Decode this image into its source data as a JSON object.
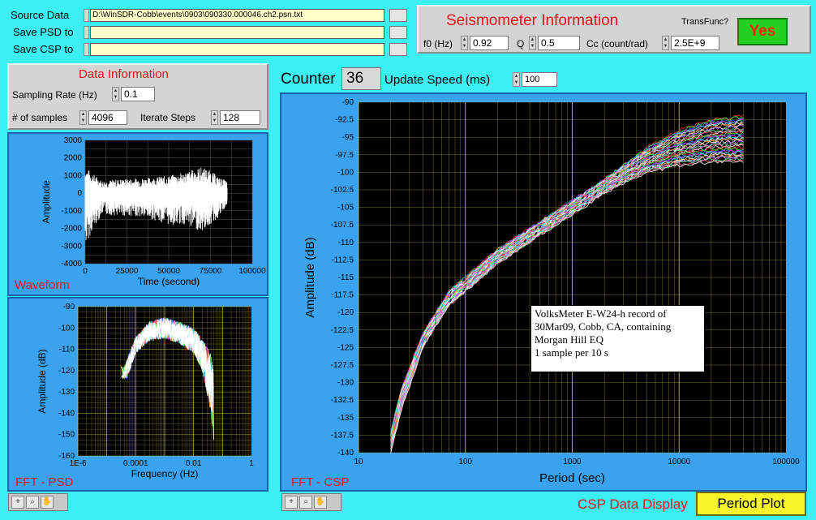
{
  "files": {
    "source_label": "Source Data",
    "source_path": "D:\\WinSDR-Cobb\\events\\0903\\090330.000046.ch2.psn.txt",
    "save_psd_label": "Save PSD to",
    "save_psd_path": "",
    "save_csp_label": "Save CSP to",
    "save_csp_path": ""
  },
  "seismometer": {
    "title": "Seismometer Information",
    "transfunc_label": "TransFunc?",
    "transfunc_button": "Yes",
    "f0_label": "f0 (Hz)",
    "f0_value": "0.92",
    "q_label": "Q",
    "q_value": "0.5",
    "cc_label": "Cc (count/rad)",
    "cc_value": "2.5E+9"
  },
  "data_info": {
    "title": "Data Information",
    "sampling_label": "Sampling Rate (Hz)",
    "sampling_value": "0.1",
    "samples_label": "# of samples",
    "samples_value": "4096",
    "iterate_label": "Iterate Steps",
    "iterate_value": "128"
  },
  "counter": {
    "label": "Counter",
    "value": "36",
    "speed_label": "Update Speed (ms)",
    "speed_value": "100"
  },
  "waveform": {
    "caption": "Waveform",
    "xlabel": "Time (second)",
    "ylabel": "Amplitude",
    "xticks": [
      "0",
      "25000",
      "50000",
      "75000",
      "100000"
    ],
    "yticks": [
      "3000",
      "2000",
      "1000",
      "0",
      "-1000",
      "-2000",
      "-3000",
      "-4000"
    ]
  },
  "psd": {
    "caption": "FFT - PSD",
    "xlabel": "Frequency (Hz)",
    "ylabel": "Amplitude (dB)",
    "xticks": [
      "1E-6",
      "0.0001",
      "0.01",
      "1"
    ],
    "yticks": [
      "-90",
      "-100",
      "-110",
      "-120",
      "-130",
      "-140",
      "-150",
      "-160"
    ]
  },
  "csp": {
    "caption": "FFT - CSP",
    "xlabel": "Period (sec)",
    "ylabel": "Amplitude (dB)",
    "xticks": [
      "10",
      "100",
      "1000",
      "10000",
      "100000"
    ],
    "yticks": [
      "-90",
      "-92.5",
      "-95",
      "-97.5",
      "-100",
      "-102.5",
      "-105",
      "-107.5",
      "-110",
      "-112.5",
      "-115",
      "-117.5",
      "-120",
      "-122.5",
      "-125",
      "-127.5",
      "-130",
      "-132.5",
      "-135",
      "-137.5",
      "-140"
    ],
    "annotation": [
      "VolksMeter E-W24-h record of",
      "30Mar09, Cobb, CA, containing",
      "Morgan Hill EQ",
      "1 sample per 10 s"
    ]
  },
  "display": {
    "label": "CSP Data Display",
    "value": "Period Plot"
  },
  "colors": {
    "title_red": "#e8101a",
    "yes_green": "#22d020",
    "display_yellow": "#f6f62a",
    "grid_yellow": "#c8c84a",
    "plot_bg": "#000000"
  },
  "chart_data": [
    {
      "type": "line",
      "title": "",
      "xlabel": "Time (second)",
      "ylabel": "Amplitude",
      "xlim": [
        0,
        100000
      ],
      "ylim": [
        -4000,
        3000
      ],
      "grid": true,
      "series": [
        {
          "x": [
            0,
            5000,
            10000,
            20000,
            30000,
            40000,
            50000,
            60000,
            70000,
            75000,
            80000,
            85000
          ],
          "y": [
            1500,
            1100,
            700,
            800,
            850,
            900,
            1000,
            1200,
            1500,
            1300,
            900,
            700
          ]
        },
        {
          "x": [
            0,
            5000,
            10000,
            20000,
            30000,
            40000,
            50000,
            60000,
            70000,
            75000,
            80000,
            85000
          ],
          "y": [
            -3000,
            -2000,
            -1200,
            -1300,
            -1300,
            -1500,
            -1800,
            -1800,
            -2200,
            -1800,
            -1400,
            -700
          ]
        }
      ]
    },
    {
      "type": "line",
      "title": "",
      "xlabel": "Frequency (Hz)",
      "ylabel": "Amplitude (dB)",
      "xscale": "log",
      "xlim": [
        1e-06,
        1
      ],
      "ylim": [
        -160,
        -90
      ],
      "grid": true,
      "series": [
        {
          "x": [
            4e-05,
            0.0001,
            0.0003,
            0.001,
            0.003,
            0.01,
            0.02,
            0.04,
            0.05
          ],
          "y": [
            -118,
            -104,
            -97,
            -95,
            -97,
            -100,
            -105,
            -112,
            -120
          ]
        },
        {
          "x": [
            5e-05,
            0.0001,
            0.0003,
            0.001,
            0.003,
            0.01,
            0.02,
            0.04,
            0.05
          ],
          "y": [
            -124,
            -112,
            -106,
            -105,
            -107,
            -112,
            -120,
            -140,
            -155
          ]
        }
      ]
    },
    {
      "type": "line",
      "title": "",
      "xlabel": "Period (sec)",
      "ylabel": "Amplitude (dB)",
      "xscale": "log",
      "xlim": [
        10,
        100000
      ],
      "ylim": [
        -140,
        -90
      ],
      "grid": true,
      "series": [
        {
          "x": [
            20,
            25,
            40,
            70,
            100,
            200,
            500,
            1000,
            2000,
            3000,
            5000,
            10000,
            20000,
            40000
          ],
          "y": [
            -137,
            -131,
            -123,
            -117,
            -115,
            -111,
            -107,
            -104,
            -101,
            -99,
            -96.5,
            -94,
            -92.5,
            -92
          ]
        },
        {
          "x": [
            20,
            25,
            40,
            70,
            100,
            200,
            500,
            1000,
            2000,
            3000,
            5000,
            10000,
            20000,
            40000
          ],
          "y": [
            -140,
            -134,
            -125,
            -119,
            -117,
            -113,
            -109,
            -106,
            -103,
            -101.5,
            -100,
            -99,
            -98.5,
            -98.5
          ]
        }
      ]
    }
  ]
}
